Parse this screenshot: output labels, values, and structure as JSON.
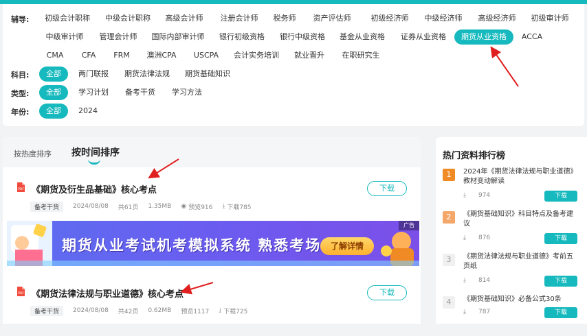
{
  "filters": {
    "tutor_label": "辅导:",
    "tutor_row1": [
      "初级会计职称",
      "中级会计职称",
      "高级会计师",
      "注册会计师",
      "税务师",
      "资产评估师",
      "初级经济师",
      "中级经济师",
      "高级经济师",
      "初级审计师"
    ],
    "tutor_row2": [
      "中级审计师",
      "管理会计师",
      "国际内部审计师",
      "银行初级资格",
      "银行中级资格",
      "基金从业资格",
      "证券从业资格",
      "期货从业资格",
      "ACCA"
    ],
    "tutor_row3": [
      "CMA",
      "CFA",
      "FRM",
      "澳洲CPA",
      "USCPA",
      "会计实务培训",
      "就业晋升",
      "在职研究生"
    ],
    "subject_label": "科目:",
    "subjects": [
      "全部",
      "两门联报",
      "期货法律法规",
      "期货基础知识"
    ],
    "type_label": "类型:",
    "types": [
      "全部",
      "学习计划",
      "备考干货",
      "学习方法"
    ],
    "year_label": "年份:",
    "years": [
      "全部",
      "2024"
    ]
  },
  "sort": {
    "hot": "按热度排序",
    "time": "按时间排序"
  },
  "items": [
    {
      "title": "《期货及衍生品基础》核心考点",
      "download": "下载",
      "tag": "备考干货",
      "date": "2024/08/08",
      "pages": "共61页",
      "size": "1.35MB",
      "views": "预览916",
      "downloads": "下载785"
    },
    {
      "title": "《期货法律法规与职业道德》核心考点",
      "download": "下载",
      "tag": "备考干货",
      "date": "2024/08/08",
      "pages": "共42页",
      "size": "0.62MB",
      "views": "预览1117",
      "downloads": "下载725"
    }
  ],
  "ad": {
    "text": "期货从业考试机考模拟系统  熟悉考场",
    "button": "了解详情",
    "tag": "广告"
  },
  "ranking": {
    "title": "热门资料排行榜",
    "items": [
      {
        "num": "1",
        "text": "2024年《期货法律法规与职业道德》教材变动解读",
        "count": "974",
        "btn": "下载"
      },
      {
        "num": "2",
        "text": "《期货基础知识》科目特点及备考建议",
        "count": "876",
        "btn": "下载"
      },
      {
        "num": "3",
        "text": "《期货法律法规与职业道德》考前五页纸",
        "count": "814",
        "btn": "下载"
      },
      {
        "num": "4",
        "text": "《期货基础知识》必备公式30条",
        "count": "787",
        "btn": "下载"
      }
    ]
  },
  "colors": {
    "accent": "#16b9bd",
    "arrow": "#e02020",
    "rank1": "#f08a24",
    "rank2": "#f5a76a",
    "rank_other": "#cccccc"
  }
}
